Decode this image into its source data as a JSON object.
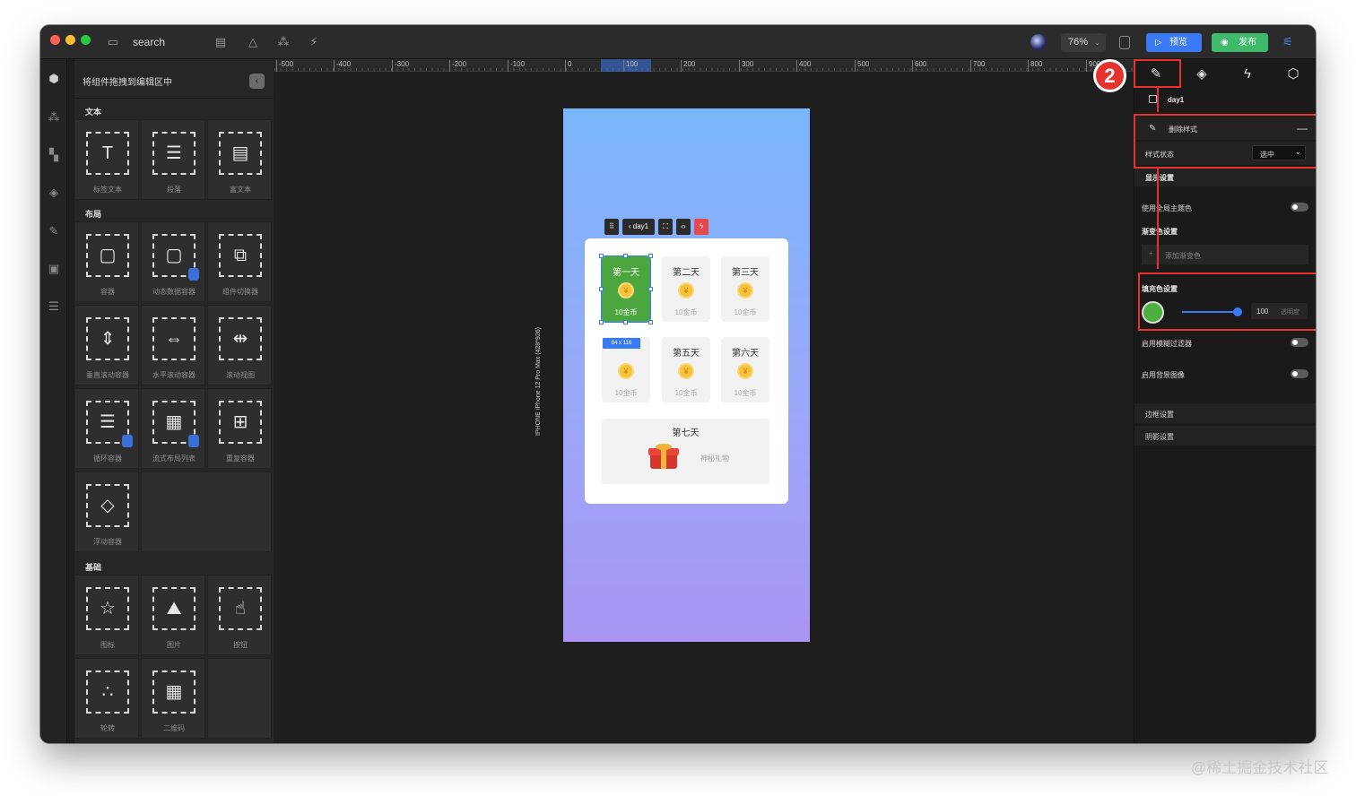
{
  "titlebar": {
    "search_label": "search",
    "zoom_value": "76%",
    "preview_label": "预览",
    "publish_label": "发布"
  },
  "panel": {
    "title": "将组件拖拽到编辑区中",
    "sections": {
      "text": "文本",
      "layout": "布局",
      "basic": "基础"
    },
    "text_items": [
      "标签文本",
      "段落",
      "富文本"
    ],
    "layout_items": [
      "容器",
      "动态数据容器",
      "组件切换器",
      "垂直滚动容器",
      "水平滚动容器",
      "滚动视图",
      "循环容器",
      "流式布局列表",
      "重复容器",
      "浮动容器"
    ],
    "basic_items": [
      "图标",
      "图片",
      "按钮",
      "轮转",
      "二维码"
    ]
  },
  "ruler": {
    "ticks": [
      "-500",
      "-400",
      "-300",
      "-200",
      "-100",
      "0",
      "100",
      "200",
      "300",
      "400",
      "500",
      "600",
      "700",
      "800",
      "900"
    ]
  },
  "canvas": {
    "device_label": "IPHONE   iPhone 12 Pro Max (428*926)",
    "breadcrumb": "day1",
    "size_badge": "84 x 116",
    "days": [
      {
        "title": "第一天",
        "reward": "10金币"
      },
      {
        "title": "第二天",
        "reward": "10金币"
      },
      {
        "title": "第三天",
        "reward": "10金币"
      },
      {
        "title": "",
        "reward": "10金币"
      },
      {
        "title": "第五天",
        "reward": "10金币"
      },
      {
        "title": "第六天",
        "reward": "10金币"
      }
    ],
    "day7_title": "第七天",
    "day7_reward": "神秘礼物",
    "coin_symbol": "¥"
  },
  "props": {
    "annotation_number": "2",
    "layer_name": "day1",
    "delete_style": "删除样式",
    "style_state_label": "样式状态",
    "style_state_value": "选中",
    "display_settings": "显示设置",
    "use_theme_color": "使用全局主题色",
    "gradient_settings": "渐变色设置",
    "add_gradient": "添加渐变色",
    "fill_settings": "填充色设置",
    "fill_color": "#4caf3f",
    "opacity_value": "100",
    "opacity_label": "透明度",
    "enable_blur": "启用模糊过滤器",
    "enable_bg_image": "启用背景图像",
    "border_settings": "边框设置",
    "shadow_settings": "阴影设置"
  },
  "watermark": "@稀土掘金技术社区",
  "colors": {
    "accent_blue": "#3a7bf5",
    "publish_green": "#3fb96a",
    "annotation_red": "#e5322d"
  }
}
